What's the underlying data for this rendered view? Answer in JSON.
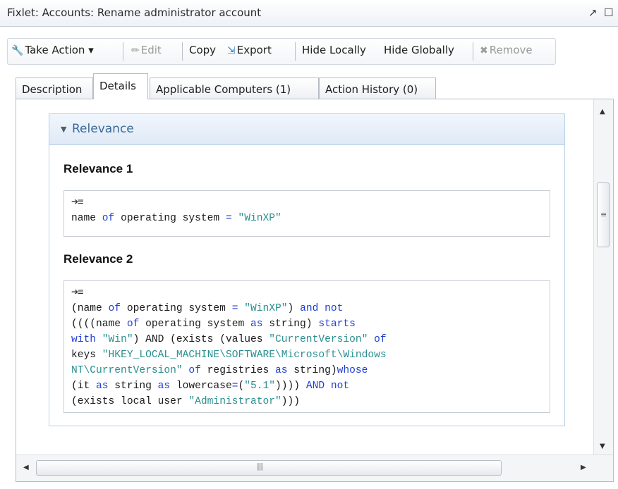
{
  "window": {
    "title": "Fixlet: Accounts: Rename administrator account",
    "icons": [
      "maximize-icon",
      "restore-icon"
    ]
  },
  "toolbar": {
    "take_action": "Take Action ▾",
    "edit": "Edit",
    "copy": "Copy",
    "export": "Export",
    "hide_locally": "Hide Locally",
    "hide_globally": "Hide Globally",
    "remove": "Remove"
  },
  "tabs": [
    {
      "label": "Description"
    },
    {
      "label": "Details"
    },
    {
      "label": "Applicable Computers (1)"
    },
    {
      "label": "Action History (0)"
    }
  ],
  "section": {
    "header": "Relevance"
  },
  "relevance": [
    {
      "title": "Relevance 1",
      "lines": [
        [
          {
            "t": "name ",
            "c": "n"
          },
          {
            "t": "of",
            "c": "kw"
          },
          {
            "t": " operating system ",
            "c": "n"
          },
          {
            "t": "=",
            "c": "kw"
          },
          {
            "t": " ",
            "c": "n"
          },
          {
            "t": "\"WinXP\"",
            "c": "str"
          }
        ]
      ]
    },
    {
      "title": "Relevance 2",
      "lines": [
        [
          {
            "t": "(name ",
            "c": "n"
          },
          {
            "t": "of",
            "c": "kw"
          },
          {
            "t": " operating system ",
            "c": "n"
          },
          {
            "t": "=",
            "c": "kw"
          },
          {
            "t": " ",
            "c": "n"
          },
          {
            "t": "\"WinXP\"",
            "c": "str"
          },
          {
            "t": ") ",
            "c": "n"
          },
          {
            "t": "and not",
            "c": "kw"
          }
        ],
        [
          {
            "t": "((((name ",
            "c": "n"
          },
          {
            "t": "of",
            "c": "kw"
          },
          {
            "t": " operating system ",
            "c": "n"
          },
          {
            "t": "as",
            "c": "kw"
          },
          {
            "t": " string) ",
            "c": "n"
          },
          {
            "t": "starts",
            "c": "kw"
          }
        ],
        [
          {
            "t": "with",
            "c": "kw"
          },
          {
            "t": " ",
            "c": "n"
          },
          {
            "t": "\"Win\"",
            "c": "str"
          },
          {
            "t": ") AND (exists (values ",
            "c": "n"
          },
          {
            "t": "\"CurrentVersion\"",
            "c": "str"
          },
          {
            "t": " ",
            "c": "n"
          },
          {
            "t": "of",
            "c": "kw"
          }
        ],
        [
          {
            "t": "keys ",
            "c": "n"
          },
          {
            "t": "\"HKEY_LOCAL_MACHINE\\SOFTWARE\\Microsoft\\Windows",
            "c": "str"
          }
        ],
        [
          {
            "t": "NT\\CurrentVersion\"",
            "c": "str"
          },
          {
            "t": " ",
            "c": "n"
          },
          {
            "t": "of",
            "c": "kw"
          },
          {
            "t": " registries ",
            "c": "n"
          },
          {
            "t": "as",
            "c": "kw"
          },
          {
            "t": " string)",
            "c": "n"
          },
          {
            "t": "whose",
            "c": "kw"
          }
        ],
        [
          {
            "t": "(it ",
            "c": "n"
          },
          {
            "t": "as",
            "c": "kw"
          },
          {
            "t": " string ",
            "c": "n"
          },
          {
            "t": "as",
            "c": "kw"
          },
          {
            "t": " lowercase",
            "c": "n"
          },
          {
            "t": "=",
            "c": "kw"
          },
          {
            "t": "(",
            "c": "n"
          },
          {
            "t": "\"5.1\"",
            "c": "str"
          },
          {
            "t": ")))) ",
            "c": "n"
          },
          {
            "t": "AND not",
            "c": "kw"
          }
        ],
        [
          {
            "t": "(exists local user ",
            "c": "n"
          },
          {
            "t": "\"Administrator\"",
            "c": "str"
          },
          {
            "t": ")))",
            "c": "n"
          }
        ]
      ]
    }
  ],
  "colors": {
    "keyword": "#1f3fd4",
    "string": "#2b8f8f",
    "section_header_text": "#3a6a9a"
  }
}
